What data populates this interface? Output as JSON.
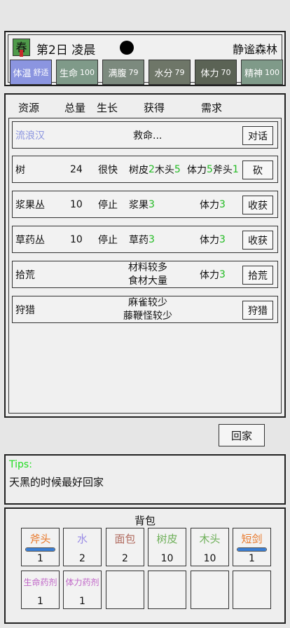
{
  "header": {
    "season": "春",
    "day": "第2日",
    "time": "凌晨",
    "location": "静谧森林",
    "colors": {
      "season_bg": "#4f9b4a"
    },
    "stats": [
      {
        "label": "体温",
        "value": "舒适",
        "color": "#8b95e0"
      },
      {
        "label": "生命",
        "value": "100",
        "color": "#7f9a89"
      },
      {
        "label": "满腹",
        "value": "79",
        "color": "#7c8a7e"
      },
      {
        "label": "水分",
        "value": "79",
        "color": "#6e7668"
      },
      {
        "label": "体力",
        "value": "70",
        "color": "#5b6355"
      },
      {
        "label": "精神",
        "value": "100",
        "color": "#7f9a89"
      }
    ]
  },
  "resources": {
    "columns": [
      "资源",
      "总量",
      "生长",
      "获得",
      "需求"
    ],
    "npc": {
      "name": "流浪汉",
      "speech": "救命...",
      "button": "对话",
      "name_color": "#8b95e0"
    },
    "rows": [
      {
        "name": "树",
        "total": "24",
        "growth": "很快",
        "gain": [
          {
            "t": "树皮"
          },
          {
            "t": "2",
            "g": true
          },
          {
            "t": "木头"
          },
          {
            "t": "5",
            "g": true
          }
        ],
        "need": [
          {
            "t": "体力"
          },
          {
            "t": "5",
            "g": true
          },
          {
            "t": "斧头"
          },
          {
            "t": "1",
            "g": true
          }
        ],
        "button": "砍"
      },
      {
        "name": "浆果丛",
        "total": "10",
        "growth": "停止",
        "gain": [
          {
            "t": "浆果"
          },
          {
            "t": "3",
            "g": true
          }
        ],
        "need": [
          {
            "t": "体力"
          },
          {
            "t": "3",
            "g": true
          }
        ],
        "button": "收获"
      },
      {
        "name": "草药丛",
        "total": "10",
        "growth": "停止",
        "gain": [
          {
            "t": "草药"
          },
          {
            "t": "3",
            "g": true
          }
        ],
        "need": [
          {
            "t": "体力"
          },
          {
            "t": "3",
            "g": true
          }
        ],
        "button": "收获"
      },
      {
        "name": "拾荒",
        "total": "",
        "growth": "",
        "gain_lines": [
          "材料较多",
          "食材大量"
        ],
        "need": [
          {
            "t": "体力"
          },
          {
            "t": "3",
            "g": true
          }
        ],
        "button": "拾荒"
      },
      {
        "name": "狩猎",
        "total": "",
        "growth": "",
        "gain_lines": [
          "麻雀较少",
          "藤鞭怪较少"
        ],
        "need": [],
        "button": "狩猎"
      }
    ]
  },
  "home_button": "回家",
  "tips": {
    "label": "Tips:",
    "text": "天黑的时候最好回家"
  },
  "bag": {
    "title": "背包",
    "items": [
      {
        "name": "斧头",
        "count": "1",
        "color": "#e8782a",
        "durability": 1.0
      },
      {
        "name": "水",
        "count": "2",
        "color": "#9b8de6"
      },
      {
        "name": "面包",
        "count": "2",
        "color": "#b06a5e"
      },
      {
        "name": "树皮",
        "count": "10",
        "color": "#6fb05a"
      },
      {
        "name": "木头",
        "count": "10",
        "color": "#6fb05a"
      },
      {
        "name": "短剑",
        "count": "1",
        "color": "#e8782a",
        "durability": 1.0
      },
      {
        "name": "生命药剂",
        "count": "1",
        "color": "#c066c8",
        "small": true
      },
      {
        "name": "体力药剂",
        "count": "1",
        "color": "#c066c8",
        "small": true
      },
      {
        "name": "",
        "count": ""
      },
      {
        "name": "",
        "count": ""
      },
      {
        "name": "",
        "count": ""
      },
      {
        "name": "",
        "count": ""
      }
    ]
  }
}
